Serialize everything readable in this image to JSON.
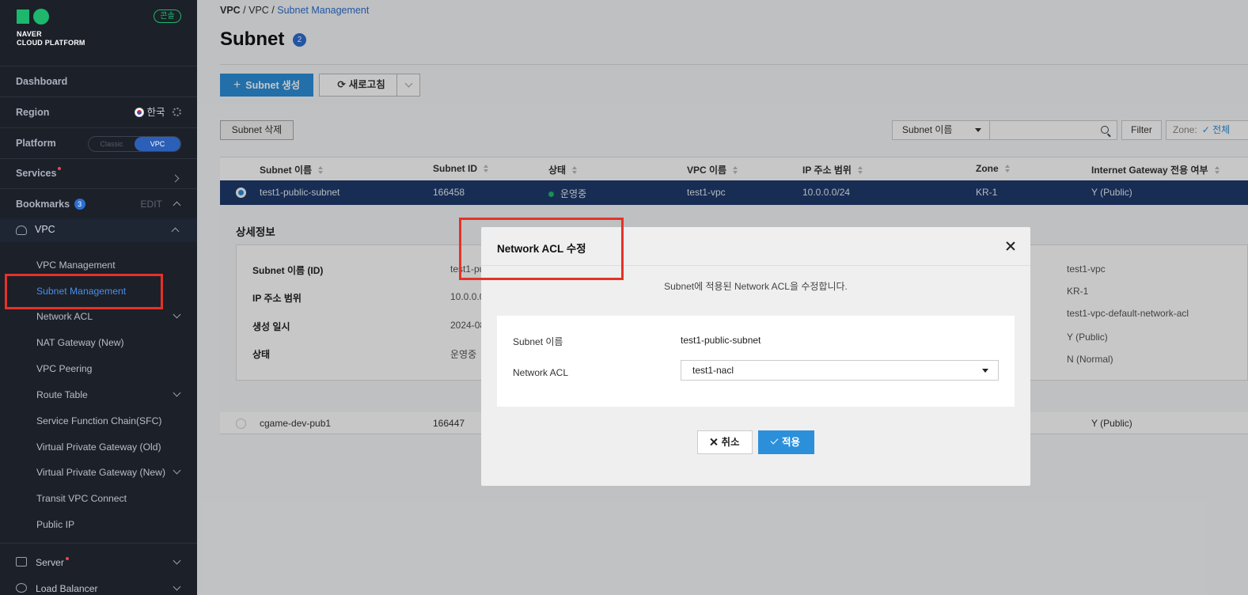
{
  "brand": {
    "line1": "NAVER",
    "line2": "CLOUD PLATFORM",
    "console_badge": "콘솔"
  },
  "sidebar": {
    "dashboard": "Dashboard",
    "region_label": "Region",
    "region_value": "한국",
    "platform_label": "Platform",
    "platform_options": [
      "Classic",
      "VPC"
    ],
    "services_label": "Services",
    "bookmarks_label": "Bookmarks",
    "bookmarks_count": "3",
    "bookmarks_edit": "EDIT",
    "vpc_group": "VPC",
    "vpc_items": [
      "VPC Management",
      "Subnet Management",
      "Network ACL",
      "NAT Gateway (New)",
      "VPC Peering",
      "Route Table",
      "Service Function Chain(SFC)",
      "Virtual Private Gateway (Old)",
      "Virtual Private Gateway (New)",
      "Transit VPC Connect",
      "Public IP"
    ],
    "server_group": "Server",
    "lb_group": "Load Balancer"
  },
  "breadcrumb": [
    "VPC",
    "VPC",
    "Subnet Management"
  ],
  "page": {
    "title": "Subnet",
    "count": "2"
  },
  "toolbar": {
    "create": "Subnet 생성",
    "refresh": "새로고침",
    "delete": "Subnet 삭제",
    "filter": "Filter",
    "search_field": "Subnet 이름",
    "zone_label": "Zone:",
    "zone_value": "전체"
  },
  "table": {
    "headers": [
      "Subnet 이름",
      "Subnet ID",
      "상태",
      "VPC 이름",
      "IP 주소 범위",
      "Zone",
      "Internet Gateway 전용 여부"
    ],
    "rows": [
      {
        "name": "test1-public-subnet",
        "id": "166458",
        "status": "운영중",
        "vpc": "test1-vpc",
        "ip": "10.0.0.0/24",
        "zone": "KR-1",
        "igw": "Y (Public)"
      },
      {
        "name": "cgame-dev-pub1",
        "id": "166447",
        "igw": "Y (Public)"
      }
    ]
  },
  "detail": {
    "title": "상세정보",
    "labels": [
      "Subnet 이름 (ID)",
      "IP 주소 범위",
      "생성 일시",
      "상태"
    ],
    "values_partial": [
      "test1-pu",
      "10.0.0.0",
      "2024-08",
      "운영중"
    ],
    "right_values": [
      "test1-vpc",
      "KR-1",
      "test1-vpc-default-network-acl",
      "Y (Public)",
      "N (Normal)"
    ]
  },
  "modal": {
    "title": "Network ACL 수정",
    "description": "Subnet에 적용된 Network ACL을 수정합니다.",
    "subnet_label": "Subnet 이름",
    "subnet_value": "test1-public-subnet",
    "acl_label": "Network ACL",
    "acl_value": "test1-nacl",
    "cancel": "취소",
    "apply": "적용"
  },
  "colors": {
    "accent": "#2c8fd9",
    "brand": "#1db76d",
    "highlight": "#e53228",
    "sidebar_bg": "#1c2029"
  }
}
